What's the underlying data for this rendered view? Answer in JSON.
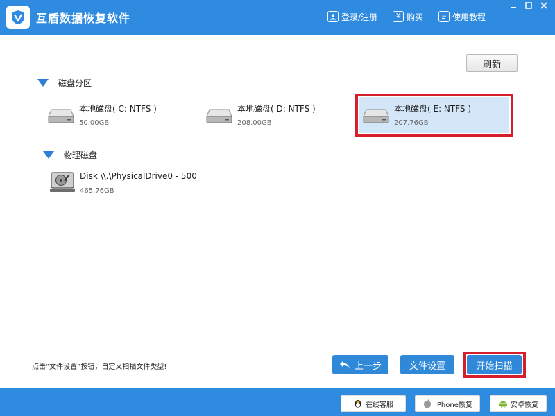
{
  "titlebar": {
    "app_name": "互盾数据恢复软件",
    "login_label": "登录/注册",
    "buy_label": "购买",
    "buy_icon_glyph": "¥",
    "tutorial_label": "使用教程",
    "minimize_glyph": "—",
    "maximize_glyph": "☐",
    "close_glyph": "✕"
  },
  "toolbar": {
    "refresh_label": "刷新"
  },
  "partitions": {
    "heading": "磁盘分区",
    "drives": [
      {
        "name": "本地磁盘( C: NTFS )",
        "size": "50.00GB"
      },
      {
        "name": "本地磁盘( D: NTFS )",
        "size": "208.00GB"
      },
      {
        "name": "本地磁盘( E: NTFS )",
        "size": "207.76GB",
        "selected": true
      }
    ]
  },
  "physical": {
    "heading": "物理磁盘",
    "disks": [
      {
        "name": "Disk \\\\.\\PhysicalDrive0 - 500",
        "size": "465.76GB"
      }
    ]
  },
  "bottom": {
    "tip": "点击“文件设置”按钮，自定义扫描文件类型!",
    "back_label": "上一步",
    "file_settings_label": "文件设置",
    "start_scan_label": "开始扫描"
  },
  "footer": {
    "online_service_label": "在线客服",
    "iphone_label": "iPhone恢复",
    "android_label": "安卓恢复"
  },
  "colors": {
    "brand_blue": "#2f8be0",
    "selection_bg": "#d3e7f9",
    "highlight_red": "#d61f2c"
  }
}
